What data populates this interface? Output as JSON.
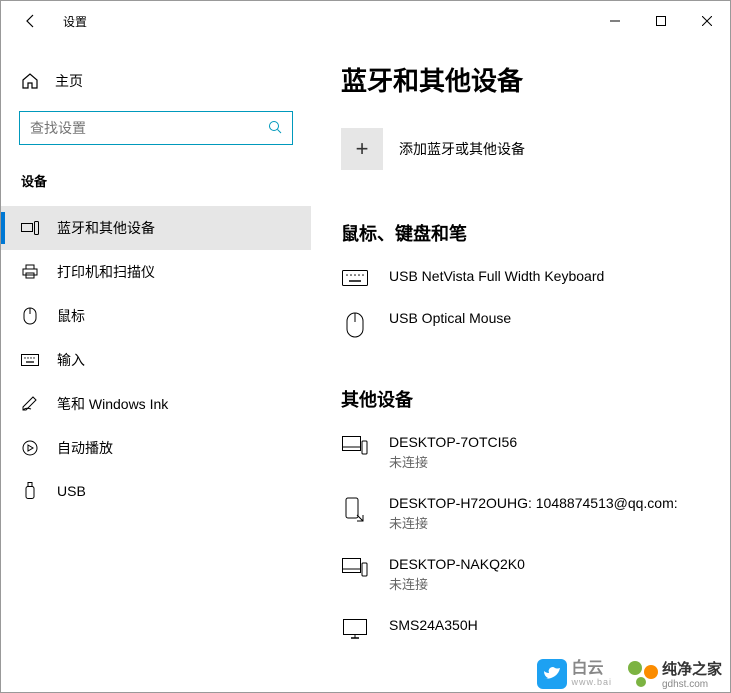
{
  "window": {
    "title": "设置"
  },
  "sidebar": {
    "home": "主页",
    "search_placeholder": "查找设置",
    "section": "设备",
    "items": [
      {
        "label": "蓝牙和其他设备"
      },
      {
        "label": "打印机和扫描仪"
      },
      {
        "label": "鼠标"
      },
      {
        "label": "输入"
      },
      {
        "label": "笔和 Windows Ink"
      },
      {
        "label": "自动播放"
      },
      {
        "label": "USB"
      }
    ]
  },
  "content": {
    "title": "蓝牙和其他设备",
    "add_label": "添加蓝牙或其他设备",
    "group1": {
      "title": "鼠标、键盘和笔",
      "devices": [
        {
          "name": "USB NetVista Full Width Keyboard"
        },
        {
          "name": "USB Optical Mouse"
        }
      ]
    },
    "group2": {
      "title": "其他设备",
      "devices": [
        {
          "name": "DESKTOP-7OTCI56",
          "status": "未连接"
        },
        {
          "name": "DESKTOP-H72OUHG: 1048874513@qq.com:",
          "status": "未连接"
        },
        {
          "name": "DESKTOP-NAKQ2K0",
          "status": "未连接"
        },
        {
          "name": "SMS24A350H"
        }
      ]
    }
  },
  "watermarks": {
    "wm1_l1": "白云",
    "wm1_l2": "www.bai",
    "wm2_l1": "纯净之家",
    "wm2_l2": "gdhst.com"
  }
}
